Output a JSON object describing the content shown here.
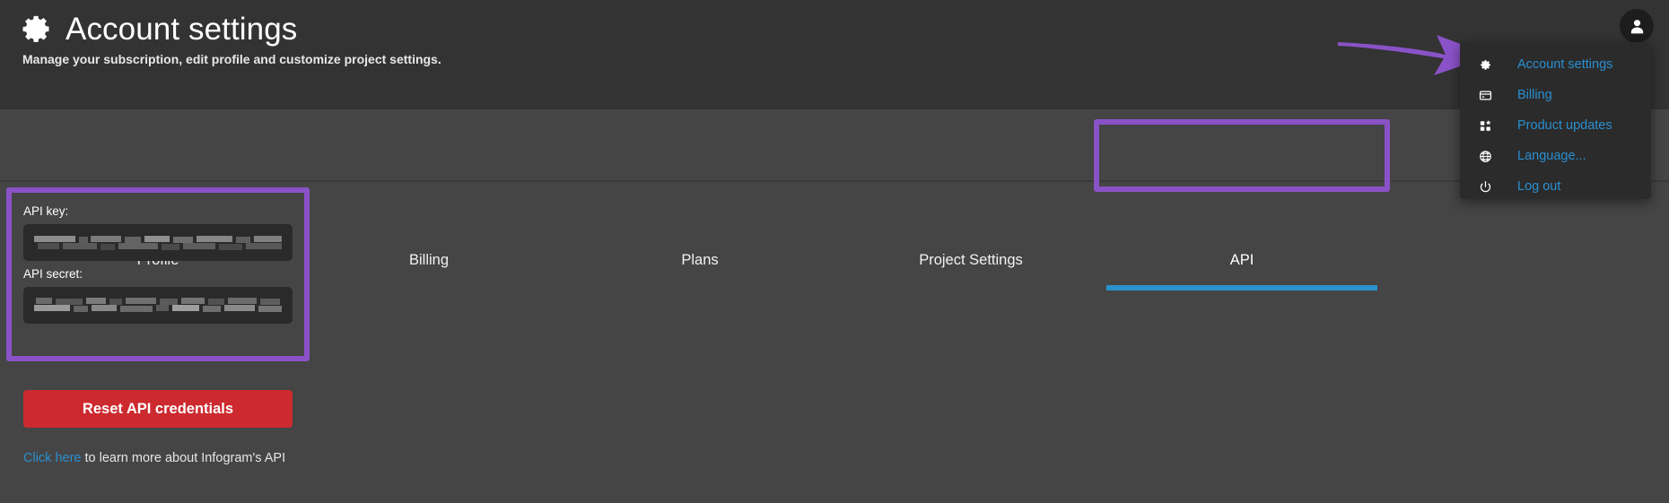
{
  "header": {
    "gear_icon": "gear-icon",
    "title": "Account settings",
    "subtitle": "Manage your subscription, edit profile and customize project settings.",
    "avatar_icon": "user-avatar-icon"
  },
  "user_menu": {
    "items": [
      {
        "icon": "gear-icon",
        "label": "Account settings"
      },
      {
        "icon": "credit-card-icon",
        "label": "Billing"
      },
      {
        "icon": "grid-star-icon",
        "label": "Product updates"
      },
      {
        "icon": "globe-icon",
        "label": "Language..."
      },
      {
        "icon": "power-icon",
        "label": "Log out"
      }
    ]
  },
  "tabs": [
    {
      "label": "Profile",
      "active": false
    },
    {
      "label": "Billing",
      "active": false
    },
    {
      "label": "Plans",
      "active": false
    },
    {
      "label": "Project Settings",
      "active": false
    },
    {
      "label": "API",
      "active": true
    }
  ],
  "api_panel": {
    "key_label": "API key:",
    "key_value": "",
    "secret_label": "API secret:",
    "secret_value": "",
    "reset_button": "Reset API credentials",
    "footer_link": "Click here",
    "footer_text": " to learn more about Infogram's API"
  },
  "colors": {
    "header_bg": "#333333",
    "content_bg": "#454545",
    "menu_bg": "#2b2b2b",
    "link_blue": "#2a8fd0",
    "tab_underline": "#2a92cd",
    "danger_red": "#cc2a2f",
    "annotation_purple": "#8a52c7",
    "input_bg": "#2a2a2a"
  }
}
